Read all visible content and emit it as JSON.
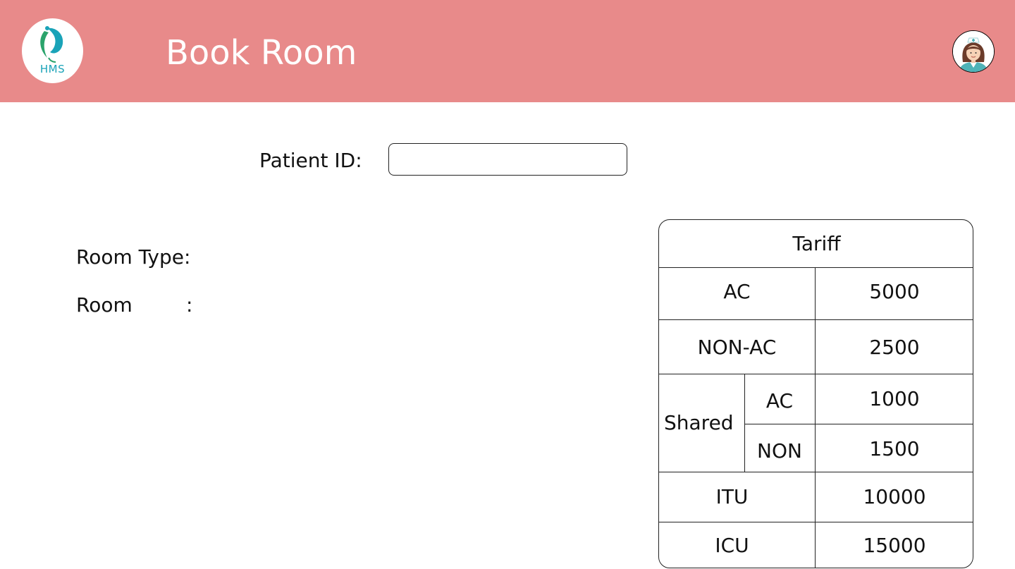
{
  "header": {
    "bg_color": "#e88a8a",
    "logo_text": "HMS",
    "logo_icon": "hms-logo-icon",
    "title": "Book Room",
    "avatar_icon": "nurse-avatar-icon"
  },
  "form": {
    "patient_id_label": "Patient ID:",
    "patient_id_value": "",
    "room_type_label": "Room Type:",
    "room_label": "Room",
    "room_colon": ":"
  },
  "tariff": {
    "title": "Tariff",
    "rows": {
      "ac": {
        "label": "AC",
        "price": "5000"
      },
      "non_ac": {
        "label": "NON-AC",
        "price": "2500"
      },
      "shared": {
        "label": "Shared",
        "ac": {
          "label": "AC",
          "price": "1000"
        },
        "non": {
          "label": "NON",
          "price": "1500"
        }
      },
      "itu": {
        "label": "ITU",
        "price": "10000"
      },
      "icu": {
        "label": "ICU",
        "price": "15000"
      }
    }
  }
}
